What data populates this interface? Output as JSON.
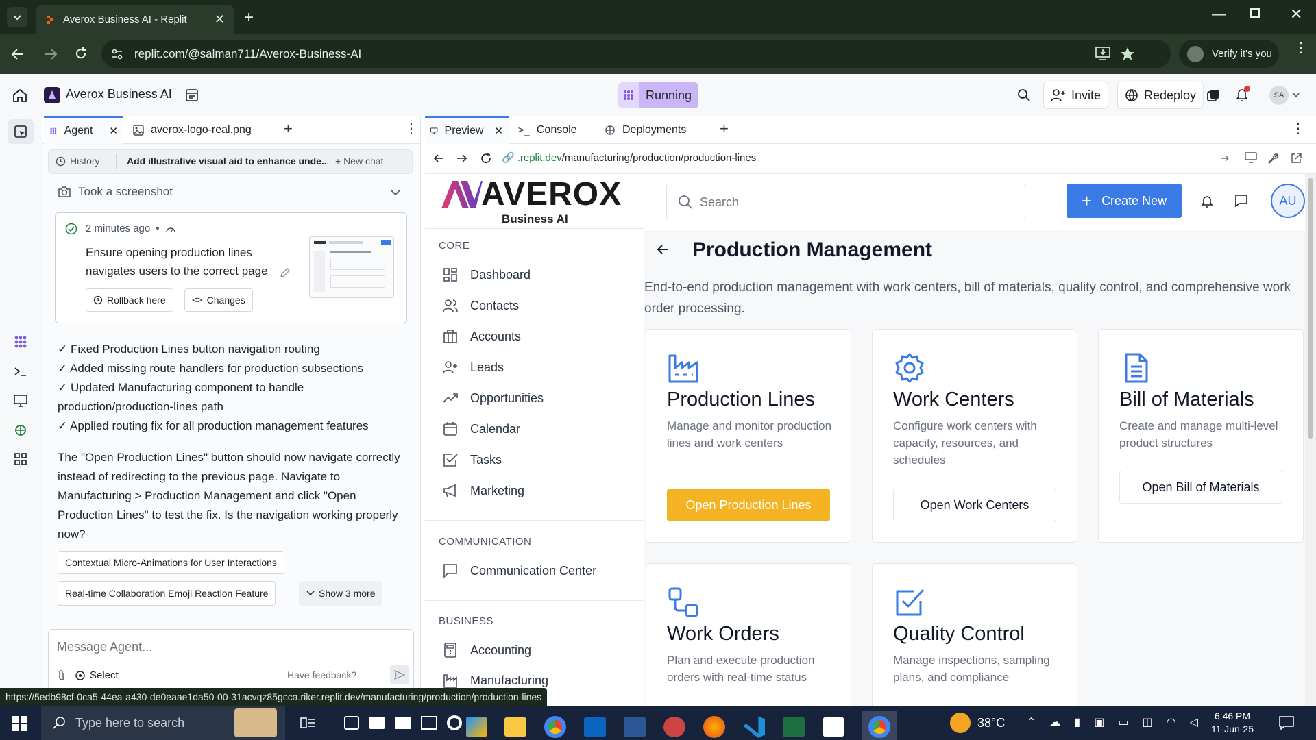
{
  "browser": {
    "tab_title": "Averox Business AI - Replit",
    "url": "replit.com/@salman711/Averox-Business-AI",
    "verify_label": "Verify it's you"
  },
  "replit": {
    "project_name": "Averox Business AI",
    "status": "Running",
    "invite_label": "Invite",
    "redeploy_label": "Redeploy",
    "avatar_initials": "SA"
  },
  "agent_tabs": {
    "agent": "Agent",
    "file": "averox-logo-real.png"
  },
  "agent": {
    "history_label": "History",
    "chat_title": "Add illustrative visual aid to enhance unde...",
    "new_chat_label": "+ New chat",
    "screenshot_label": "Took a screenshot",
    "checkpoint_time": "2 minutes ago",
    "checkpoint_text": "Ensure opening production lines navigates users to the correct page",
    "rollback_label": "Rollback here",
    "changes_label": "Changes",
    "fixes": [
      "✓ Fixed Production Lines button navigation routing",
      "✓ Added missing route handlers for production subsections",
      "✓ Updated Manufacturing component to handle production/production-lines path",
      "✓ Applied routing fix for all production management features"
    ],
    "message": "The \"Open Production Lines\" button should now navigate correctly instead of redirecting to the previous page. Navigate to Manufacturing > Production Management and click \"Open Production Lines\" to test the fix. Is the navigation working properly now?",
    "suggestions": [
      "Contextual Micro-Animations for User Interactions",
      "Real-time Collaboration Emoji Reaction Feature"
    ],
    "show_more_label": "Show 3 more",
    "input_placeholder": "Message Agent...",
    "select_label": "Select",
    "feedback_label": "Have feedback?"
  },
  "preview_tabs": {
    "preview": "Preview",
    "console": "Console",
    "deployments": "Deployments"
  },
  "preview": {
    "url_domain": ".replit.dev",
    "url_path": "/manufacturing/production/production-lines"
  },
  "app": {
    "logo_text": "AVEROX",
    "logo_sub": "Business AI",
    "search_placeholder": "Search",
    "create_new_label": "Create New",
    "avatar_initials": "AU",
    "sections": {
      "core": "CORE",
      "communication": "COMMUNICATION",
      "business": "BUSINESS"
    },
    "nav": {
      "dashboard": "Dashboard",
      "contacts": "Contacts",
      "accounts": "Accounts",
      "leads": "Leads",
      "opportunities": "Opportunities",
      "calendar": "Calendar",
      "tasks": "Tasks",
      "marketing": "Marketing",
      "communication_center": "Communication Center",
      "accounting": "Accounting",
      "manufacturing": "Manufacturing"
    },
    "page_title": "Production Management",
    "page_desc": "End-to-end production management with work centers, bill of materials, quality control, and comprehensive work order processing.",
    "cards": [
      {
        "title": "Production Lines",
        "desc": "Manage and monitor production lines and work centers",
        "button": "Open Production Lines"
      },
      {
        "title": "Work Centers",
        "desc": "Configure work centers with capacity, resources, and schedules",
        "button": "Open Work Centers"
      },
      {
        "title": "Bill of Materials",
        "desc": "Create and manage multi-level product structures",
        "button": "Open Bill of Materials"
      },
      {
        "title": "Work Orders",
        "desc": "Plan and execute production orders with real-time status"
      },
      {
        "title": "Quality Control",
        "desc": "Manage inspections, sampling plans, and compliance"
      }
    ]
  },
  "status_url": "https://5edb98cf-0ca5-44ea-a430-de0eaae1da50-00-31acvqz85gcca.riker.replit.dev/manufacturing/production/production-lines",
  "taskbar": {
    "search_placeholder": "Type here to search",
    "temperature": "38°C",
    "time": "6:46 PM",
    "date": "11-Jun-25"
  },
  "colors": {
    "primary_blue": "#3b7be5",
    "accent_orange": "#f3b323",
    "running_purple": "#c9b6f7"
  }
}
